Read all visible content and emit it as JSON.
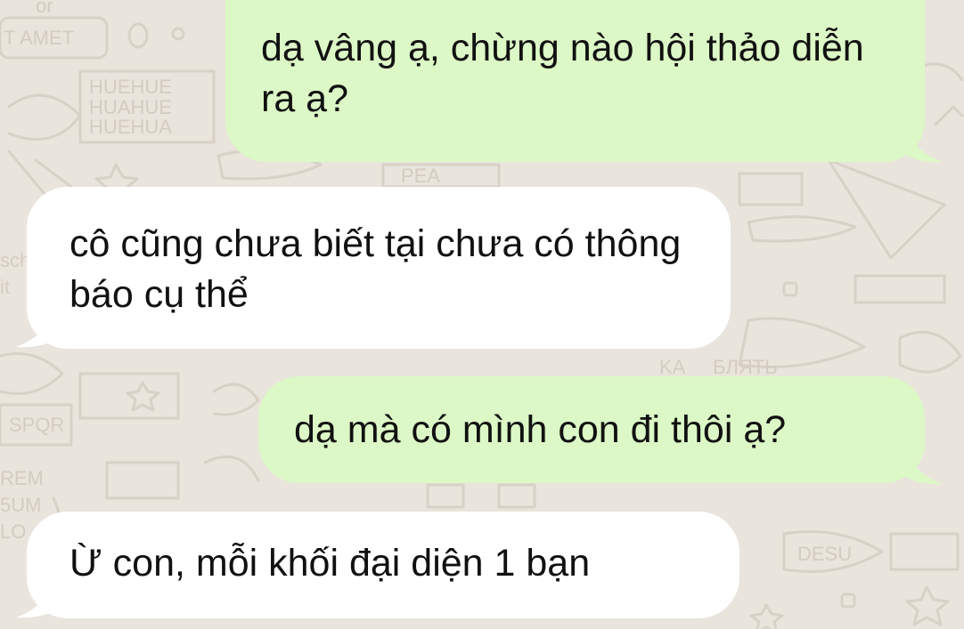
{
  "colors": {
    "wallpaper": "#e9e4dc",
    "doodle": "#d8d1c6",
    "outgoing_bubble": "#dcf8c6",
    "incoming_bubble": "#ffffff",
    "text": "#111111"
  },
  "wallpaper_doodles": [
    "T AMET",
    "HUEHUE",
    "HUAHUE",
    "HUEHUA",
    "PEA",
    "БЛЯТЬ",
    "KA",
    "SPQR",
    "REM",
    "5UM",
    "LO",
    "DESU",
    "sch",
    "it",
    "or"
  ],
  "messages": [
    {
      "direction": "outgoing",
      "text": "dạ vâng ạ, chừng nào hội thảo diễn ra ạ?"
    },
    {
      "direction": "incoming",
      "text": "cô cũng chưa biết tại chưa có thông báo cụ thể"
    },
    {
      "direction": "outgoing",
      "text": "dạ mà có mình con đi thôi ạ?"
    },
    {
      "direction": "incoming",
      "text": "Ừ con, mỗi khối đại diện 1 bạn"
    }
  ]
}
